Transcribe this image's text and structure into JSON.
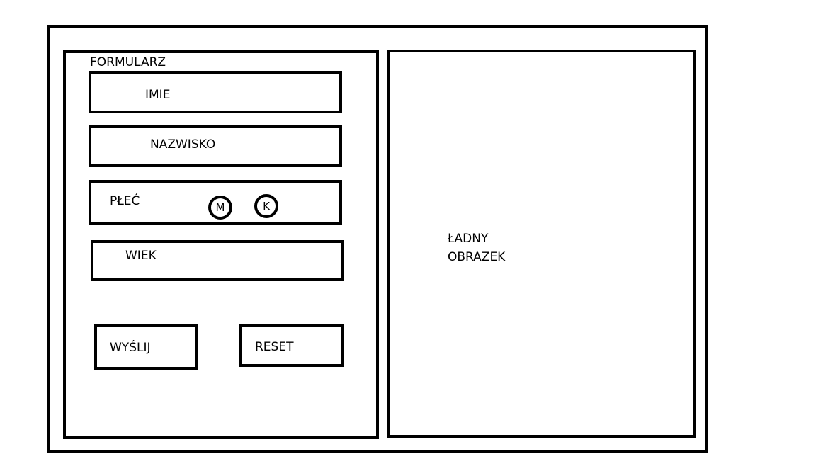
{
  "form": {
    "title": "FORMULARZ",
    "first_name_label": "IMIE",
    "last_name_label": "NAZWISKO",
    "gender_label": "PŁEĆ",
    "gender_options": [
      "M",
      "K"
    ],
    "age_label": "WIEK",
    "submit_label": "WYŚLIJ",
    "reset_label": "RESET"
  },
  "image_panel": {
    "label_line1": "ŁADNY",
    "label_line2": "OBRAZEK"
  }
}
